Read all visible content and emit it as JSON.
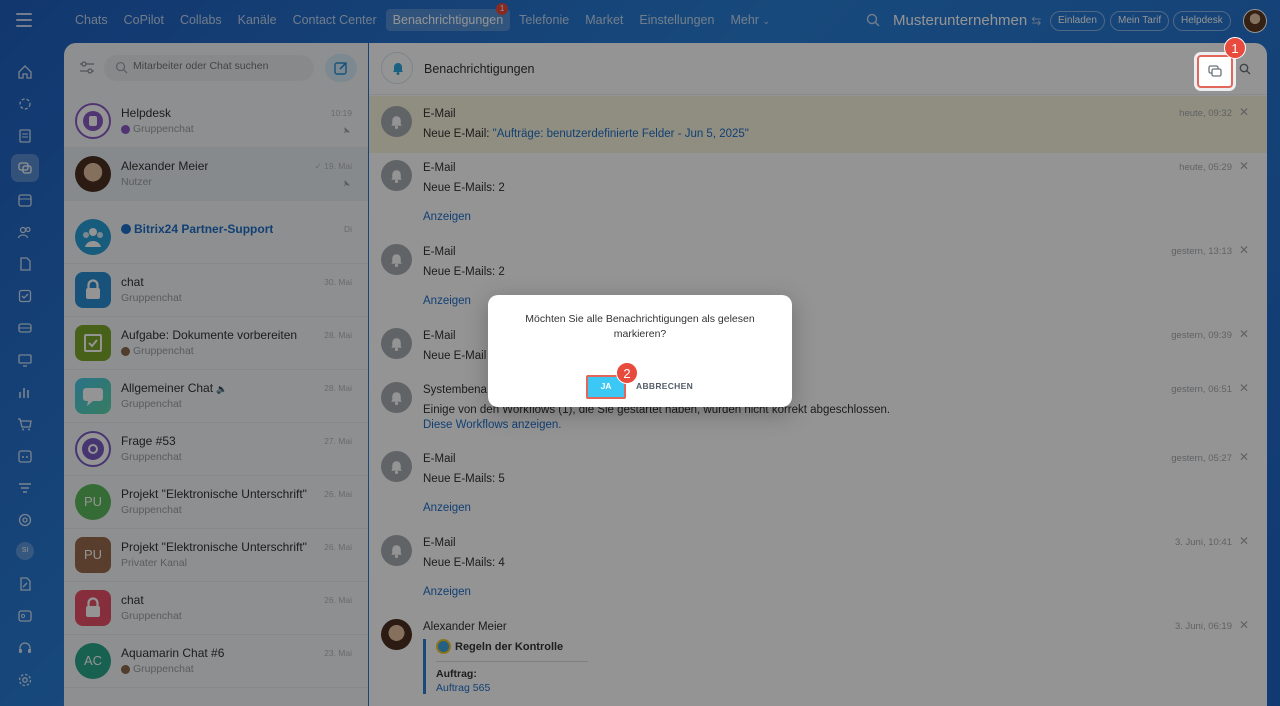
{
  "topbar": {
    "tabs": [
      {
        "label": "Chats"
      },
      {
        "label": "CoPilot"
      },
      {
        "label": "Collabs"
      },
      {
        "label": "Kanäle"
      },
      {
        "label": "Contact Center"
      },
      {
        "label": "Benachrichtigungen",
        "badge": "1",
        "active": true
      },
      {
        "label": "Telefonie"
      },
      {
        "label": "Market"
      },
      {
        "label": "Einstellungen"
      },
      {
        "label": "Mehr"
      }
    ],
    "company": "Musterunternehmen",
    "invite": "Einladen",
    "plan": "Mein Tarif",
    "helpdesk": "Helpdesk"
  },
  "rail": {
    "si_label": "SI"
  },
  "chat_list": {
    "search_placeholder": "Mitarbeiter oder Chat suchen",
    "items": [
      {
        "name": "Helpdesk",
        "sub": "Gruppenchat",
        "time": "10:19"
      },
      {
        "name": "Alexander Meier",
        "sub": "Nutzer",
        "time": "19. Mai"
      },
      {
        "name": "Bitrix24 Partner-Support",
        "sub": "",
        "time": "Di"
      },
      {
        "name": "chat",
        "sub": "Gruppenchat",
        "time": "30. Mai"
      },
      {
        "name": "Aufgabe: Dokumente vorbereiten",
        "sub": "Gruppenchat",
        "time": "28. Mai"
      },
      {
        "name": "Allgemeiner Chat",
        "sub": "Gruppenchat",
        "time": "28. Mai"
      },
      {
        "name": "Frage #53",
        "sub": "Gruppenchat",
        "time": "27. Mai"
      },
      {
        "name": "Projekt \"Elektronische Unterschrift\"",
        "sub": "Gruppenchat",
        "time": "26. Mai",
        "initials": "PU"
      },
      {
        "name": "Projekt \"Elektronische Unterschrift\"",
        "sub": "Privater Kanal",
        "time": "26. Mai",
        "initials": "PU"
      },
      {
        "name": "chat",
        "sub": "Gruppenchat",
        "time": "26. Mai"
      },
      {
        "name": "Aquamarin Chat #6",
        "sub": "Gruppenchat",
        "time": "23. Mai",
        "initials": "AC"
      }
    ]
  },
  "main": {
    "title": "Benachrichtigungen",
    "notifications": [
      {
        "title": "E-Mail",
        "text_prefix": "Neue E-Mail: ",
        "text_link": "\"Aufträge: benutzerdefinierte Felder - Jun 5, 2025\"",
        "time": "heute, 09:32"
      },
      {
        "title": "E-Mail",
        "text": "Neue E-Mails: 2",
        "link": "Anzeigen",
        "time": "heute, 05:29"
      },
      {
        "title": "E-Mail",
        "text": "Neue E-Mails: 2",
        "link": "Anzeigen",
        "time": "gestern, 13:13"
      },
      {
        "title": "E-Mail",
        "text": "Neue E-Mail",
        "time": "gestern, 09:39"
      },
      {
        "title": "Systembena",
        "text": "Einige von den Workflows (1), die Sie gestartet haben, wurden nicht korrekt abgeschlossen.",
        "link": "Diese Workflows anzeigen.",
        "time": "gestern, 06:51"
      },
      {
        "title": "E-Mail",
        "text": "Neue E-Mails: 5",
        "link": "Anzeigen",
        "time": "gestern, 05:27"
      },
      {
        "title": "E-Mail",
        "text": "Neue E-Mails: 4",
        "link": "Anzeigen",
        "time": "3. Juni, 10:41"
      },
      {
        "title": "Alexander Meier",
        "time": "3. Juni, 06:19",
        "card_title": "Regeln der Kontrolle",
        "card_label": "Auftrag:",
        "card_value": "Auftrag 565"
      }
    ]
  },
  "steps": {
    "one": "1",
    "two": "2"
  },
  "dialog": {
    "text": "Möchten Sie alle Benachrichtigungen als gelesen markieren?",
    "yes": "JA",
    "cancel": "ABBRECHEN"
  }
}
